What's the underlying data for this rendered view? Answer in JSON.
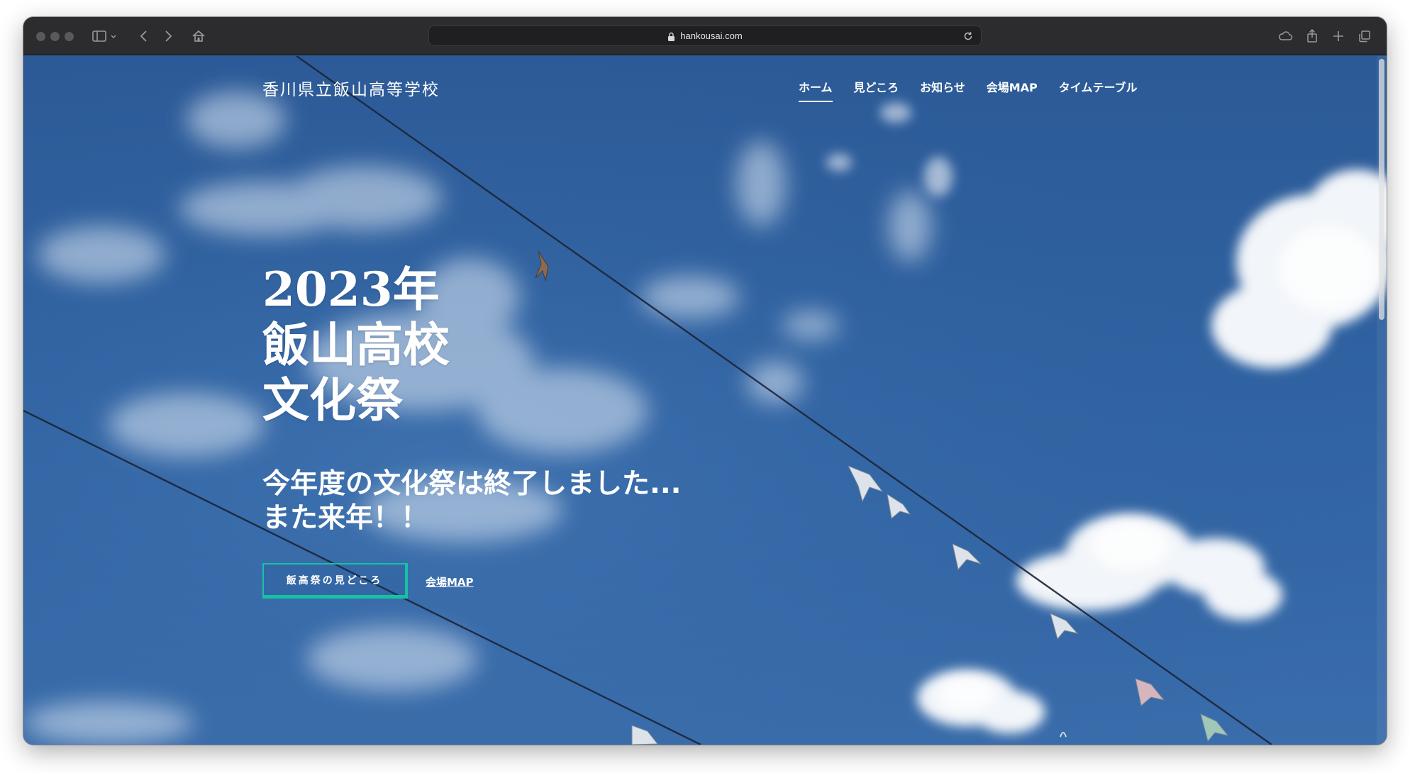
{
  "browser": {
    "url": "hankousai.com",
    "icons": [
      "sidebar-icon",
      "chevron-down-icon",
      "back-icon",
      "forward-icon",
      "home-icon",
      "lock-icon",
      "reload-icon",
      "icloud-icon",
      "share-icon",
      "new-tab-icon",
      "tabs-overview-icon"
    ]
  },
  "site": {
    "title": "香川県立飯山高等学校",
    "nav": [
      {
        "label": "ホーム",
        "active": true
      },
      {
        "label": "見どころ",
        "active": false
      },
      {
        "label": "お知らせ",
        "active": false
      },
      {
        "label": "会場MAP",
        "active": false
      },
      {
        "label": "タイムテーブル",
        "active": false
      }
    ]
  },
  "hero": {
    "title_lines": [
      "2023年",
      "飯山高校",
      "文化祭"
    ],
    "message_lines": [
      "今年度の文化祭は終了しました...",
      "また来年！！"
    ],
    "primary_button": "飯高祭の見どころ",
    "secondary_link": "会場MAP"
  },
  "colors": {
    "sky": "#2f62a1",
    "accent": "#16c2a4",
    "toolbar": "#2c2c2e"
  }
}
